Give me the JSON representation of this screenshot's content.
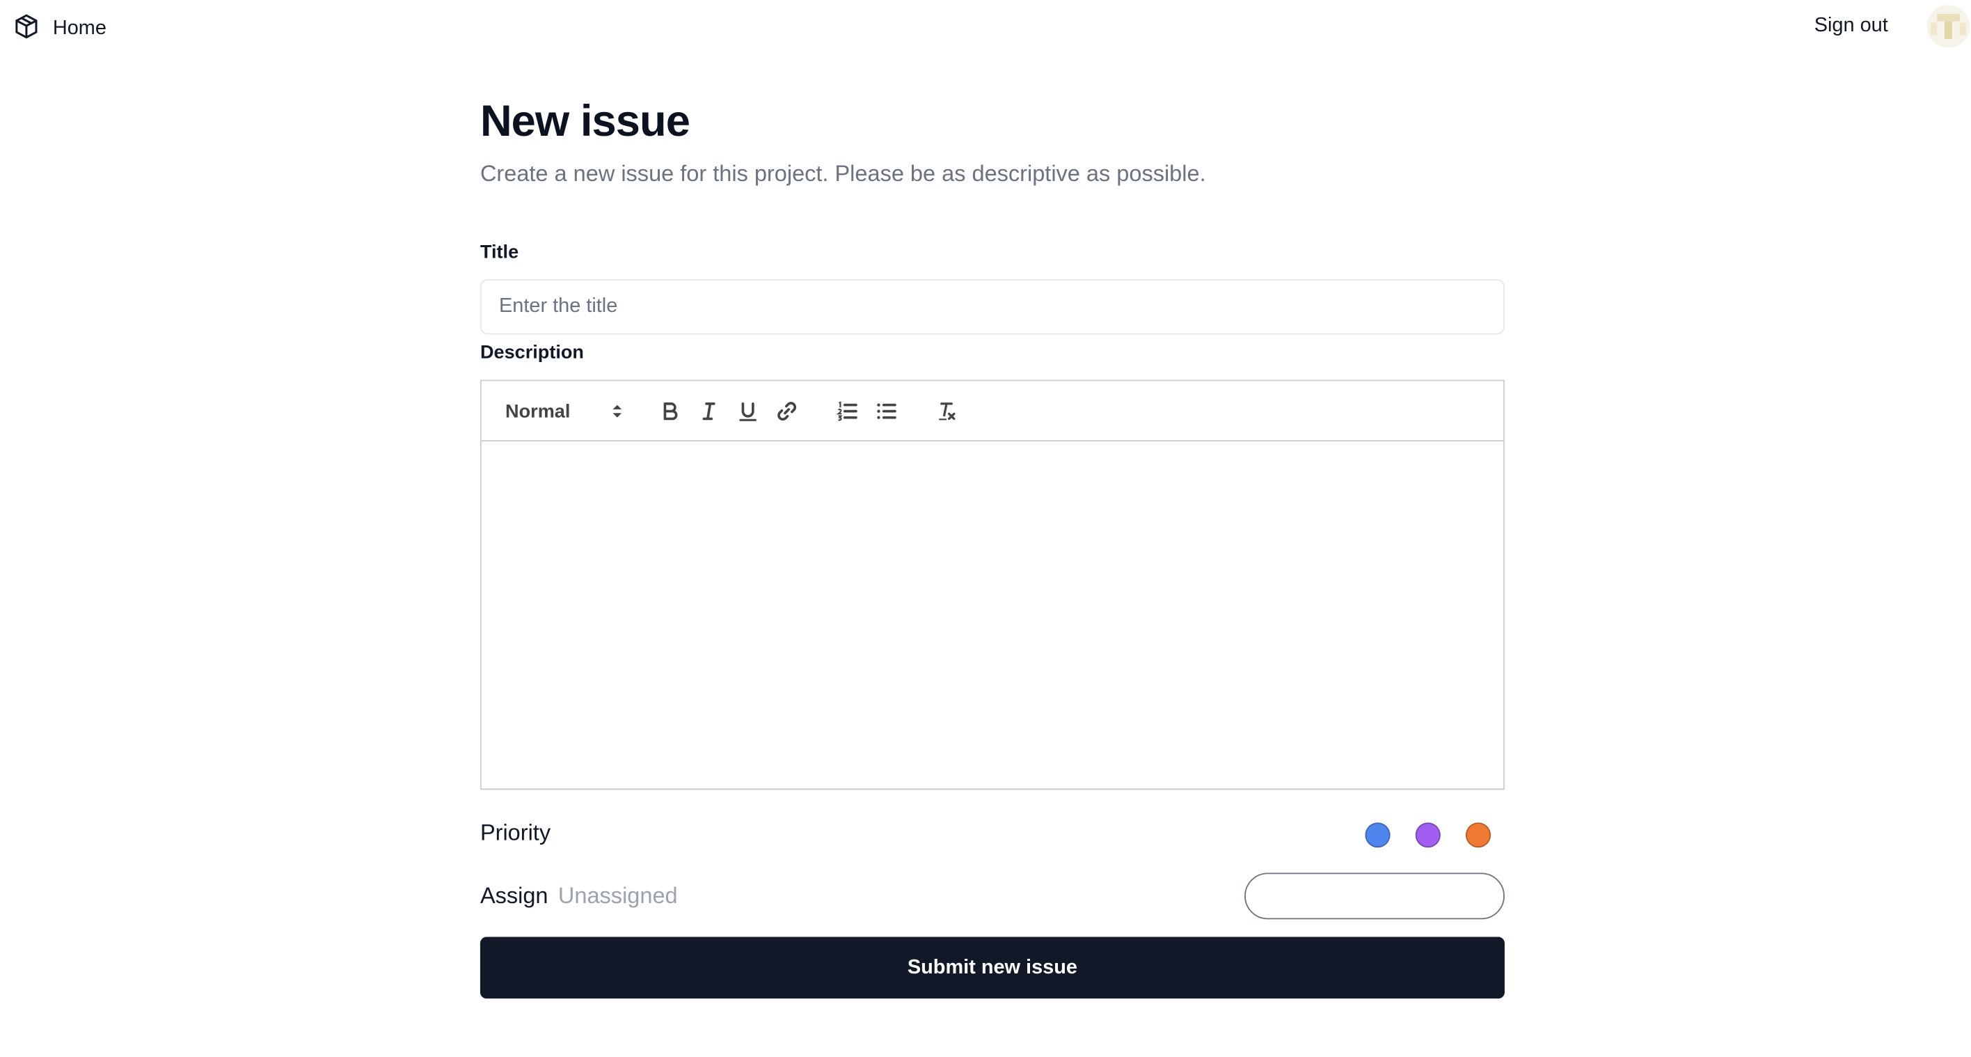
{
  "nav": {
    "home_label": "Home",
    "home_icon": "cube-icon",
    "sign_out_label": "Sign out",
    "avatar_alt": "user-avatar"
  },
  "page": {
    "title": "New issue",
    "subtitle": "Create a new issue for this project. Please be as descriptive as possible."
  },
  "form": {
    "title_label": "Title",
    "title_placeholder": "Enter the title",
    "title_value": "",
    "description_label": "Description",
    "description_value": "",
    "editor_toolbar": {
      "format_selected": "Normal",
      "buttons": [
        "bold-icon",
        "italic-icon",
        "underline-icon",
        "link-icon",
        "ordered-list-icon",
        "bullet-list-icon",
        "clear-format-icon"
      ]
    },
    "priority_label": "Priority",
    "priority_colors": [
      "#4f86ee",
      "#a15ef1",
      "#ef7a34"
    ],
    "assign_label": "Assign",
    "assign_value": "Unassigned",
    "assign_search_value": "",
    "submit_label": "Submit new issue"
  },
  "colors": {
    "primary_button": "#111827",
    "muted_text": "#6b7280"
  }
}
